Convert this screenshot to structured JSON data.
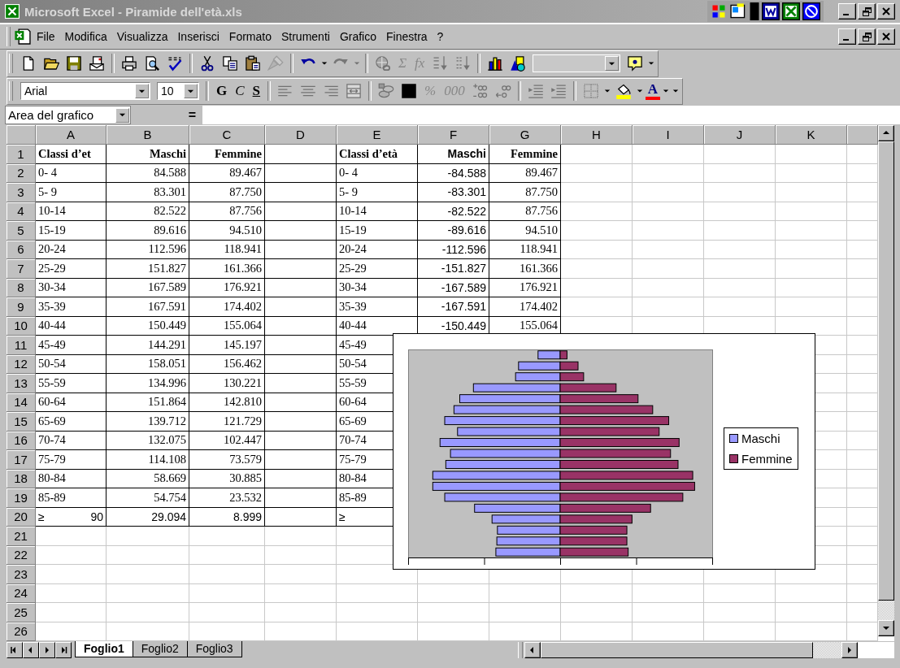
{
  "window": {
    "title": "Microsoft Excel - Piramide dell'età.xls"
  },
  "menu": [
    "File",
    "Modifica",
    "Visualizza",
    "Inserisci",
    "Formato",
    "Strumenti",
    "Grafico",
    "Finestra",
    "?"
  ],
  "toolbars": [
    {
      "items": [
        {
          "kind": "icon",
          "disabled": false
        },
        {
          "kind": "icon",
          "disabled": false
        },
        {
          "kind": "icon",
          "disabled": false
        },
        {
          "kind": "icon",
          "disabled": false
        },
        {
          "kind": "separator"
        },
        {
          "kind": "icon",
          "disabled": false
        },
        {
          "kind": "icon",
          "disabled": false
        },
        {
          "kind": "icon",
          "disabled": false
        },
        {
          "kind": "separator"
        },
        {
          "kind": "icon",
          "disabled": false
        },
        {
          "kind": "icon",
          "disabled": false
        },
        {
          "kind": "icon",
          "disabled": false
        },
        {
          "kind": "icon",
          "disabled": true
        },
        {
          "kind": "separator"
        },
        {
          "kind": "icon",
          "disabled": false
        },
        {
          "kind": "caret",
          "disabled": false
        },
        {
          "kind": "icon",
          "disabled": true
        },
        {
          "kind": "caret",
          "disabled": true
        },
        {
          "kind": "separator"
        },
        {
          "kind": "icon",
          "disabled": true
        },
        {
          "kind": "text",
          "label": "Σ",
          "disabled": true
        },
        {
          "kind": "text",
          "label": "fx",
          "disabled": true
        },
        {
          "kind": "icon",
          "disabled": true
        },
        {
          "kind": "icon",
          "disabled": true
        },
        {
          "kind": "separator"
        },
        {
          "kind": "icon",
          "disabled": false
        },
        {
          "kind": "icon",
          "disabled": false
        },
        {
          "kind": "combo",
          "disabled": true
        },
        {
          "kind": "icon",
          "disabled": false
        },
        {
          "kind": "caret",
          "disabled": false
        }
      ]
    },
    {
      "items": [
        {
          "kind": "combo",
          "value": "Arial",
          "disabled": false
        },
        {
          "kind": "combo",
          "value": "10",
          "disabled": false
        },
        {
          "kind": "separator"
        },
        {
          "kind": "bold-toggle",
          "label": "G",
          "disabled": false
        },
        {
          "kind": "italic-toggle",
          "label": "C",
          "disabled": false
        },
        {
          "kind": "underline-toggle",
          "label": "S",
          "disabled": false
        },
        {
          "kind": "separator"
        },
        {
          "kind": "icon",
          "disabled": true
        },
        {
          "kind": "icon",
          "disabled": true
        },
        {
          "kind": "icon",
          "disabled": true
        },
        {
          "kind": "icon",
          "disabled": true
        },
        {
          "kind": "separator"
        },
        {
          "kind": "icon",
          "disabled": true
        },
        {
          "kind": "icon",
          "disabled": false
        },
        {
          "kind": "text",
          "label": "%",
          "disabled": true
        },
        {
          "kind": "text",
          "label": "000",
          "disabled": true
        },
        {
          "kind": "icon",
          "disabled": true
        },
        {
          "kind": "icon",
          "disabled": true
        },
        {
          "kind": "separator"
        },
        {
          "kind": "icon",
          "disabled": true
        },
        {
          "kind": "icon",
          "disabled": true
        },
        {
          "kind": "separator"
        },
        {
          "kind": "icon",
          "disabled": true
        },
        {
          "kind": "caret",
          "disabled": false
        },
        {
          "kind": "icon",
          "disabled": false
        },
        {
          "kind": "caret",
          "disabled": false
        },
        {
          "kind": "color-text",
          "label": "A",
          "disabled": false
        },
        {
          "kind": "caret",
          "disabled": false
        },
        {
          "kind": "caret",
          "disabled": false
        }
      ]
    }
  ],
  "formula_bar": {
    "name_box": "Area del grafico",
    "equals": "="
  },
  "sheet": {
    "columns": [
      "A",
      "B",
      "C",
      "D",
      "E",
      "F",
      "G",
      "H",
      "I",
      "J",
      "K"
    ],
    "rows": [
      {
        "number": "1",
        "cells": {
          "A": "Classi d’et",
          "B": "Maschi",
          "C": "Femmine",
          "E": "Classi d’età",
          "F": "Maschi",
          "G": "Femmine"
        }
      },
      {
        "number": "2",
        "cells": {
          "A": "0- 4",
          "B": "84.588",
          "C": "89.467",
          "E": "0- 4",
          "F": "-84.588",
          "G": "89.467"
        }
      },
      {
        "number": "3",
        "cells": {
          "A": "5- 9",
          "B": "83.301",
          "C": "87.750",
          "E": "5- 9",
          "F": "-83.301",
          "G": "87.750"
        }
      },
      {
        "number": "4",
        "cells": {
          "A": "10-14",
          "B": "82.522",
          "C": "87.756",
          "E": "10-14",
          "F": "-82.522",
          "G": "87.756"
        }
      },
      {
        "number": "5",
        "cells": {
          "A": "15-19",
          "B": "89.616",
          "C": "94.510",
          "E": "15-19",
          "F": "-89.616",
          "G": "94.510"
        }
      },
      {
        "number": "6",
        "cells": {
          "A": "20-24",
          "B": "112.596",
          "C": "118.941",
          "E": "20-24",
          "F": "-112.596",
          "G": "118.941"
        }
      },
      {
        "number": "7",
        "cells": {
          "A": "25-29",
          "B": "151.827",
          "C": "161.366",
          "E": "25-29",
          "F": "-151.827",
          "G": "161.366"
        }
      },
      {
        "number": "8",
        "cells": {
          "A": "30-34",
          "B": "167.589",
          "C": "176.921",
          "E": "30-34",
          "F": "-167.589",
          "G": "176.921"
        }
      },
      {
        "number": "9",
        "cells": {
          "A": "35-39",
          "B": "167.591",
          "C": "174.402",
          "E": "35-39",
          "F": "-167.591",
          "G": "174.402"
        }
      },
      {
        "number": "10",
        "cells": {
          "A": "40-44",
          "B": "150.449",
          "C": "155.064",
          "E": "40-44",
          "F": "-150.449",
          "G": "155.064"
        }
      },
      {
        "number": "11",
        "cells": {
          "A": "45-49",
          "B": "144.291",
          "C": "145.197",
          "E": "45-49"
        }
      },
      {
        "number": "12",
        "cells": {
          "A": "50-54",
          "B": "158.051",
          "C": "156.462",
          "E": "50-54"
        }
      },
      {
        "number": "13",
        "cells": {
          "A": "55-59",
          "B": "134.996",
          "C": "130.221",
          "E": "55-59"
        }
      },
      {
        "number": "14",
        "cells": {
          "A": "60-64",
          "B": "151.864",
          "C": "142.810",
          "E": "60-64"
        }
      },
      {
        "number": "15",
        "cells": {
          "A": "65-69",
          "B": "139.712",
          "C": "121.729",
          "E": "65-69"
        }
      },
      {
        "number": "16",
        "cells": {
          "A": "70-74",
          "B": "132.075",
          "C": "102.447",
          "E": "70-74"
        }
      },
      {
        "number": "17",
        "cells": {
          "A": "75-79",
          "B": "114.108",
          "C": "73.579",
          "E": "75-79"
        }
      },
      {
        "number": "18",
        "cells": {
          "A": "80-84",
          "B": "58.669",
          "C": "30.885",
          "E": "80-84"
        }
      },
      {
        "number": "19",
        "cells": {
          "A": "85-89",
          "B": "54.754",
          "C": "23.532",
          "E": "85-89"
        }
      },
      {
        "number": "20",
        "cells": {
          "A": "≥ 90",
          "B": "29.094",
          "C": "8.999",
          "E": "≥"
        }
      },
      {
        "number": "21"
      },
      {
        "number": "22"
      },
      {
        "number": "23"
      },
      {
        "number": "24"
      },
      {
        "number": "25"
      },
      {
        "number": "26"
      }
    ]
  },
  "chart": {
    "legend": [
      {
        "label": "Maschi",
        "color": "#9999ff"
      },
      {
        "label": "Femmine",
        "color": "#993366"
      }
    ]
  },
  "sheet_tabs": [
    {
      "label": "Foglio1",
      "selected": true
    },
    {
      "label": "Foglio2",
      "selected": false
    },
    {
      "label": "Foglio3",
      "selected": false
    }
  ]
}
